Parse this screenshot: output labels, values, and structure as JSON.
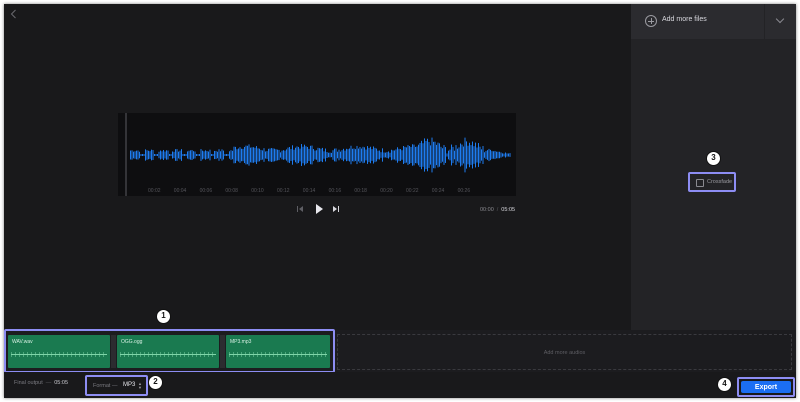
{
  "header": {
    "back_icon": "chevron-left-icon"
  },
  "waveform": {
    "color": "#1e7cf0",
    "tick_labels": [
      "00:02",
      "00:04",
      "00:06",
      "00:08",
      "00:10",
      "00:12",
      "00:14",
      "00:16",
      "00:18",
      "00:20",
      "00:22",
      "00:24",
      "00:26"
    ]
  },
  "player": {
    "icons": [
      "skip-back-icon",
      "play-icon",
      "skip-forward-icon"
    ],
    "current_time": "00:00",
    "separator": "/",
    "total_time": "05:05"
  },
  "sidebar": {
    "add_files_label": "Add more files",
    "crossfade_label": "Crossfade"
  },
  "tracks": [
    {
      "name": "WAV.wav"
    },
    {
      "name": "OGG.ogg"
    },
    {
      "name": "MP3.mp3"
    }
  ],
  "add_audios_label": "Add more audios",
  "footer": {
    "final_output_label": "Final output",
    "final_output_dash": "—",
    "final_output_duration": "05:05",
    "format_label": "Format —",
    "format_value": "MP3",
    "export_label": "Export"
  },
  "callouts": [
    "1",
    "2",
    "3",
    "4"
  ],
  "colors": {
    "accent": "#1b6ef3",
    "highlight": "#8d8df3",
    "clip": "#1a7a50"
  }
}
